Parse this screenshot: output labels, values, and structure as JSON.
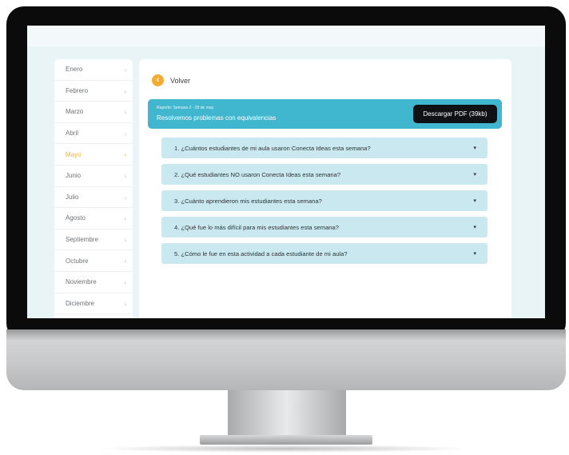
{
  "sidebar": {
    "months": [
      {
        "label": "Enero"
      },
      {
        "label": "Febrero"
      },
      {
        "label": "Marzo"
      },
      {
        "label": "Abril"
      },
      {
        "label": "Mayo",
        "active": true
      },
      {
        "label": "Junio"
      },
      {
        "label": "Julio"
      },
      {
        "label": "Agosto"
      },
      {
        "label": "Septiembre"
      },
      {
        "label": "Octubre"
      },
      {
        "label": "Noviembre"
      },
      {
        "label": "Diciembre"
      }
    ],
    "chevron_icon": "chevron-right-icon"
  },
  "back": {
    "label": "Volver",
    "icon": "arrow-left-icon"
  },
  "report": {
    "kicker": "Reporte: Semana 2 - 09 de may.",
    "title": "Resolvemos problemas con equivalencias",
    "download_label": "Descargar PDF (39kb)"
  },
  "questions": [
    "1. ¿Cuántos estudiantes de mi aula usaron Conecta Ideas esta semana?",
    "2. ¿Qué estudiantes NO usaron Conecta Ideas esta semana?",
    "3. ¿Cuánto aprendieron mis estudiantes esta semana?",
    "4. ¿Qué fue lo más difícil para mis estudiantes esta semana?",
    "5. ¿Cómo le fue en esta actividad a cada estudiante de mi aula?"
  ],
  "colors": {
    "accent": "#f2ac33",
    "header": "#40b6cf",
    "question_bg": "#c9e8f0",
    "button_dark": "#0f1114"
  }
}
